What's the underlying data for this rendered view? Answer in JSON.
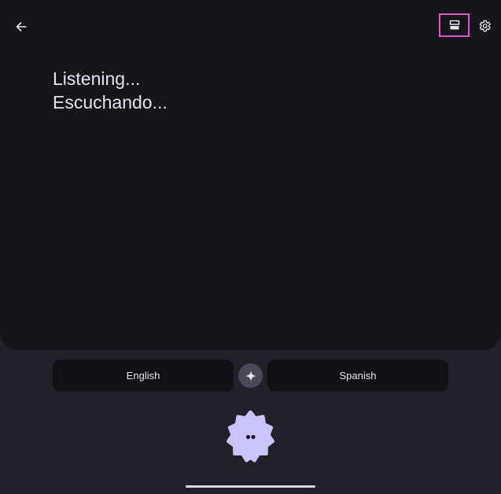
{
  "transcript": {
    "source_text": "Listening...",
    "target_text": "Escuchando..."
  },
  "languages": {
    "source": "English",
    "target": "Spanish"
  },
  "icons": {
    "back": "arrow-left-icon",
    "layout": "split-view-icon",
    "settings": "gear-icon",
    "swap": "sparkle-icon",
    "mic": "listening-dots-icon"
  },
  "colors": {
    "panel": "#16151c",
    "background": "#22212a",
    "highlight": "#e052c6",
    "mic": "#c9c4fa",
    "pill": "#111016"
  }
}
